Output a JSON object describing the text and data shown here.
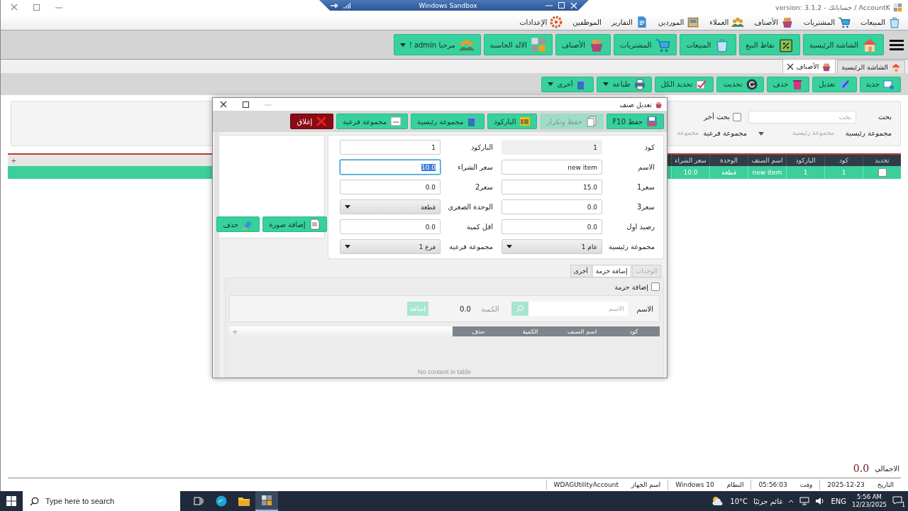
{
  "window": {
    "title": "AccountK / حساباتك - version: 3.1.2"
  },
  "sandbox_bar": {
    "title": "Windows Sandbox"
  },
  "menu": [
    {
      "label": "المبيعات"
    },
    {
      "label": "المشتريات"
    },
    {
      "label": "الأصناف"
    },
    {
      "label": "العملاء"
    },
    {
      "label": "الموردين"
    },
    {
      "label": "التقارير"
    },
    {
      "label": "الموظفين"
    },
    {
      "label": "الإعدادات"
    }
  ],
  "main_toolbar": [
    {
      "label": "الشاشة الرئيسية",
      "dropdown": false
    },
    {
      "label": "نقاط البيع",
      "dropdown": false
    },
    {
      "label": "المبيعات",
      "dropdown": false
    },
    {
      "label": "المشتريات",
      "dropdown": false
    },
    {
      "label": "الأصناف",
      "dropdown": false
    },
    {
      "label": "الالة الحاسبة",
      "dropdown": false
    },
    {
      "label": "مرحبا admin !",
      "dropdown": true
    }
  ],
  "tabs": [
    {
      "label": "الشاشة الرئيسية",
      "selected": false,
      "closable": false
    },
    {
      "label": "الأصناف",
      "selected": true,
      "closable": true
    }
  ],
  "actions": [
    {
      "label": "جديد",
      "dropdown": false
    },
    {
      "label": "تعديل",
      "dropdown": false
    },
    {
      "label": "حذف",
      "dropdown": false
    },
    {
      "label": "تحديث",
      "dropdown": false
    },
    {
      "label": "تحديد الكل",
      "dropdown": false
    },
    {
      "label": "طباعة",
      "dropdown": true
    },
    {
      "label": "أخرى",
      "dropdown": true
    }
  ],
  "search": {
    "label": "بحث",
    "placeholder": "بحث",
    "other_search": {
      "label": "بحث أخر",
      "checked": false
    },
    "main_group": {
      "label": "مجموعة رئيسية",
      "placeholder": "مجموعة رئيسية"
    },
    "sub_group": {
      "label": "مجموعة فرعية",
      "placeholder": "مجموعة"
    }
  },
  "table": {
    "columns": [
      "تحديد",
      "كود",
      "الباركود",
      "اسم الصنف",
      "الوحدة",
      "سعر الشراء"
    ],
    "corner": "+",
    "rows": [
      {
        "checked": false,
        "cells": [
          "",
          "1",
          "1",
          "new item",
          "قطعة",
          "10.0"
        ]
      }
    ]
  },
  "total": {
    "label": "الاجمالي",
    "value": "0.0"
  },
  "status_bar": [
    {
      "label": "التاريخ",
      "value": "2025-12-23"
    },
    {
      "label": "وقت",
      "value": "05:56:03"
    },
    {
      "label": "النظام",
      "value": "Windows 10"
    },
    {
      "label": "اسم الجهاز",
      "value": "WDAGUtilityAccount"
    }
  ],
  "dialog": {
    "title": "تعديل صنف",
    "toolbar": [
      {
        "label": "حفظ F10",
        "kind": "normal",
        "disabled": false
      },
      {
        "label": "حفظ وتكرار",
        "kind": "normal",
        "disabled": true
      },
      {
        "label": "الباركود",
        "kind": "normal",
        "disabled": false
      },
      {
        "label": "مجموعة رئيسية",
        "kind": "normal",
        "disabled": false
      },
      {
        "label": "مجموعة فرعية",
        "kind": "normal",
        "disabled": false
      },
      {
        "label": "إغلاق",
        "kind": "danger",
        "disabled": false
      }
    ],
    "fields": [
      {
        "label": "كود",
        "kind": "readonly",
        "value": "1",
        "focused": false
      },
      {
        "label": "الباركود",
        "kind": "text",
        "value": "1",
        "focused": false
      },
      {
        "label": "الاسم",
        "kind": "text",
        "value": "new item",
        "focused": false
      },
      {
        "label": "سعر الشراء",
        "kind": "text",
        "value": "10.0",
        "focused": true
      },
      {
        "label": "سعر1",
        "kind": "text",
        "value": "15.0",
        "focused": false
      },
      {
        "label": "سعر2",
        "kind": "text",
        "value": "0.0",
        "focused": false
      },
      {
        "label": "سعر3",
        "kind": "text",
        "value": "0.0",
        "focused": false
      },
      {
        "label": "الوحدة الصغرى",
        "kind": "select",
        "value": "قطعة",
        "focused": false
      },
      {
        "label": "رصيد اول",
        "kind": "text",
        "value": "0.0",
        "focused": false
      },
      {
        "label": "اقل كمية",
        "kind": "text",
        "value": "0.0",
        "focused": false
      },
      {
        "label": "مجموعة رئيسية",
        "kind": "select",
        "value": "عام 1",
        "focused": false
      },
      {
        "label": "مجموعة فرعية",
        "kind": "select",
        "value": "فرع 1",
        "focused": false
      }
    ],
    "image_buttons": [
      "إضافة صورة",
      "حذف"
    ],
    "tabs": [
      {
        "label": "الوحدات",
        "selected": false,
        "disabled": true
      },
      {
        "label": "إضافة حزمة",
        "selected": true,
        "disabled": false
      },
      {
        "label": "أخرى",
        "selected": false,
        "disabled": false
      }
    ],
    "package": {
      "checkbox": {
        "label": "إضافة حزمة",
        "checked": false
      },
      "name_label": "الاسم",
      "name_placeholder": "الاسم",
      "quantity_label": "الكمية",
      "quantity": "0.0",
      "add_button": {
        "label": "إضافة",
        "disabled": true
      },
      "columns": [
        "كود",
        "اسم الصنف",
        "الكمية",
        "حذف"
      ],
      "corner": "+",
      "empty_text": "No content in table"
    }
  },
  "taskbar": {
    "search_placeholder": "Type here to search",
    "temperature": "10°C",
    "weather": "غائم جزئيًا",
    "language": "ENG",
    "time": "5:56 AM",
    "date": "12/23/2025",
    "notifications": "1"
  }
}
